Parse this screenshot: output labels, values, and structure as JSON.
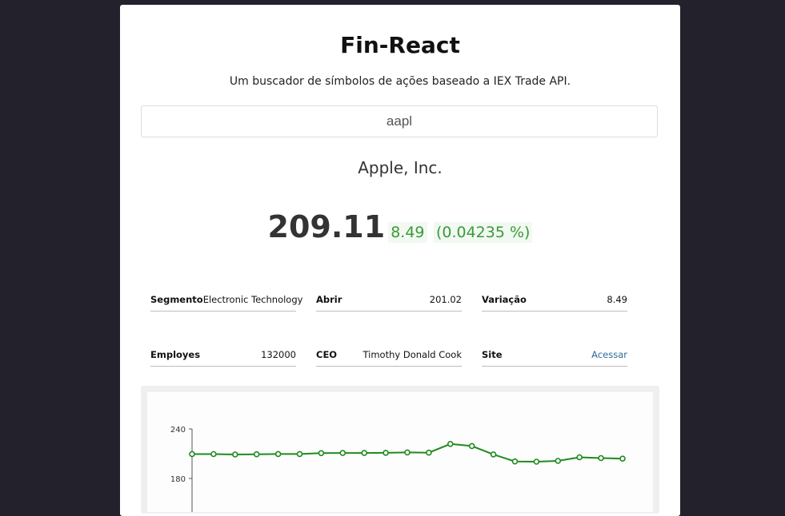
{
  "app": {
    "title": "Fin-React",
    "subtitle": "Um buscador de símbolos de ações baseado a IEX Trade API."
  },
  "search": {
    "value": "aapl"
  },
  "quote": {
    "company": "Apple, Inc.",
    "price": "209.11",
    "change": "8.49",
    "change_percent": "(0.04235 %)"
  },
  "info": {
    "segment": {
      "label": "Segmento",
      "value": "Electronic Technology"
    },
    "open": {
      "label": "Abrir",
      "value": "201.02"
    },
    "variation": {
      "label": "Variação",
      "value": "8.49"
    },
    "employees": {
      "label": "Employes",
      "value": "132000"
    },
    "ceo": {
      "label": "CEO",
      "value": "Timothy Donald Cook"
    },
    "site": {
      "label": "Site",
      "value": "Acessar"
    }
  },
  "colors": {
    "background": "#23222c",
    "positive": "#3a9a3a",
    "line": "#1e8a1e",
    "link": "#2b6a9a"
  },
  "chart_data": {
    "type": "line",
    "y_ticks": [
      "240",
      "180"
    ],
    "ylim": [
      180,
      240
    ],
    "series": [
      {
        "values": [
          209.5,
          209.5,
          209.0,
          209.3,
          209.6,
          209.6,
          210.7,
          210.9,
          210.9,
          211.1,
          211.5,
          211.3,
          221.8,
          219.3,
          209.1,
          200.6,
          200.3,
          201.3,
          205.6,
          204.7,
          204.0
        ]
      }
    ],
    "grid": false
  }
}
